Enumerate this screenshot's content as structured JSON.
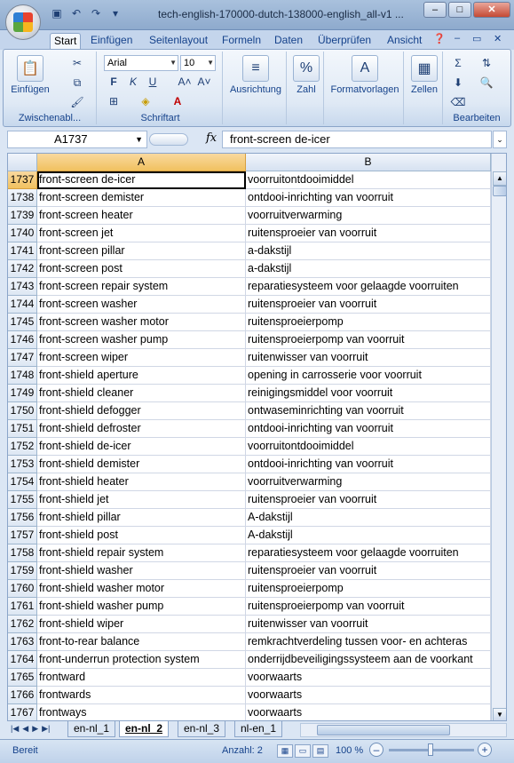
{
  "window": {
    "title": "tech-english-170000-dutch-138000-english_all-v1 ..."
  },
  "tabs": [
    "Start",
    "Einfügen",
    "Seitenlayout",
    "Formeln",
    "Daten",
    "Überprüfen",
    "Ansicht"
  ],
  "ribbon": {
    "clipboard": {
      "paste_label": "Einfügen",
      "group_label": "Zwischenabl..."
    },
    "font": {
      "name": "Arial",
      "size": "10",
      "group_label": "Schriftart"
    },
    "alignment_label": "Ausrichtung",
    "number_label": "Zahl",
    "styles_label": "Formatvorlagen",
    "cells_label": "Zellen",
    "editing_label": "Bearbeiten"
  },
  "formula_bar": {
    "name_box": "A1737",
    "fx": "fx",
    "content": "front-screen de-icer"
  },
  "columns": [
    "A",
    "B"
  ],
  "rows": [
    {
      "num": "1737",
      "a": "front-screen de-icer",
      "b": "voorruitontdooimiddel"
    },
    {
      "num": "1738",
      "a": "front-screen demister",
      "b": "ontdooi-inrichting van voorruit"
    },
    {
      "num": "1739",
      "a": "front-screen heater",
      "b": "voorruitverwarming"
    },
    {
      "num": "1740",
      "a": "front-screen jet",
      "b": "ruitensproeier van voorruit"
    },
    {
      "num": "1741",
      "a": "front-screen pillar",
      "b": "a-dakstijl"
    },
    {
      "num": "1742",
      "a": "front-screen post",
      "b": "a-dakstijl"
    },
    {
      "num": "1743",
      "a": "front-screen repair system",
      "b": "reparatiesysteem voor gelaagde voorruiten"
    },
    {
      "num": "1744",
      "a": "front-screen washer",
      "b": "ruitensproeier van voorruit"
    },
    {
      "num": "1745",
      "a": "front-screen washer motor",
      "b": "ruitensproeierpomp"
    },
    {
      "num": "1746",
      "a": "front-screen washer pump",
      "b": "ruitensproeierpomp van voorruit"
    },
    {
      "num": "1747",
      "a": "front-screen wiper",
      "b": "ruitenwisser van voorruit"
    },
    {
      "num": "1748",
      "a": "front-shield aperture",
      "b": "opening in carrosserie voor voorruit"
    },
    {
      "num": "1749",
      "a": "front-shield cleaner",
      "b": "reinigingsmiddel voor voorruit"
    },
    {
      "num": "1750",
      "a": "front-shield defogger",
      "b": "ontwaseminrichting van voorruit"
    },
    {
      "num": "1751",
      "a": "front-shield defroster",
      "b": "ontdooi-inrichting van voorruit"
    },
    {
      "num": "1752",
      "a": "front-shield de-icer",
      "b": "voorruitontdooimiddel"
    },
    {
      "num": "1753",
      "a": "front-shield demister",
      "b": "ontdooi-inrichting van voorruit"
    },
    {
      "num": "1754",
      "a": "front-shield heater",
      "b": "voorruitverwarming"
    },
    {
      "num": "1755",
      "a": "front-shield jet",
      "b": "ruitensproeier van voorruit"
    },
    {
      "num": "1756",
      "a": "front-shield pillar",
      "b": "A-dakstijl"
    },
    {
      "num": "1757",
      "a": "front-shield post",
      "b": "A-dakstijl"
    },
    {
      "num": "1758",
      "a": "front-shield repair system",
      "b": "reparatiesysteem voor gelaagde voorruiten"
    },
    {
      "num": "1759",
      "a": "front-shield washer",
      "b": "ruitensproeier van voorruit"
    },
    {
      "num": "1760",
      "a": "front-shield washer motor",
      "b": "ruitensproeierpomp"
    },
    {
      "num": "1761",
      "a": "front-shield washer pump",
      "b": "ruitensproeierpomp van voorruit"
    },
    {
      "num": "1762",
      "a": "front-shield wiper",
      "b": "ruitenwisser van voorruit"
    },
    {
      "num": "1763",
      "a": "front-to-rear balance",
      "b": "remkrachtverdeling tussen voor- en achteras"
    },
    {
      "num": "1764",
      "a": "front-underrun protection system",
      "b": "onderrijdbeveiligingssysteem aan de voorkant"
    },
    {
      "num": "1765",
      "a": "frontward",
      "b": "voorwaarts"
    },
    {
      "num": "1766",
      "a": "frontwards",
      "b": "voorwaarts"
    },
    {
      "num": "1767",
      "a": "frontways",
      "b": "voorwaarts"
    }
  ],
  "sheets": [
    "en-nl_1",
    "en-nl_2",
    "en-nl_3",
    "nl-en_1"
  ],
  "status": {
    "ready": "Bereit",
    "count": "Anzahl: 2",
    "zoom": "100 %"
  }
}
